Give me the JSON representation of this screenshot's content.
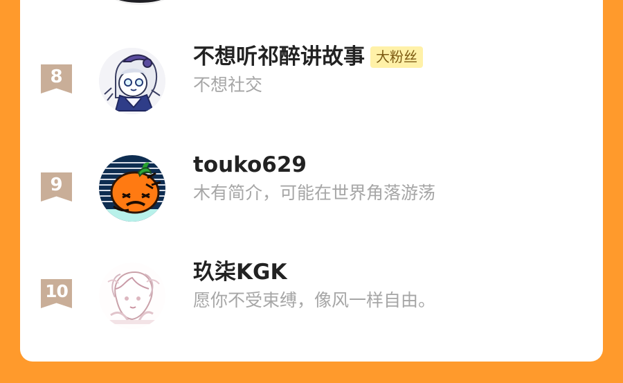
{
  "leaderboard": {
    "entries": [
      {
        "rank": "8",
        "username": "不想听祁醉讲故事",
        "badge": "大粉丝",
        "bio": "不想社交",
        "avatar_icon": "anime-girl-portrait-avatar"
      },
      {
        "rank": "9",
        "username": "touko629",
        "badge": "",
        "bio": "木有简介，可能在世界角落游荡",
        "avatar_icon": "angry-orange-mascot-avatar"
      },
      {
        "rank": "10",
        "username": "玖柒KGK",
        "badge": "",
        "bio": "愿你不受束缚，像风一样自由。",
        "avatar_icon": "pink-sketch-girl-avatar"
      }
    ]
  },
  "colors": {
    "background": "#FF9A2C",
    "card": "#FFFFFF",
    "rank_badge": "#C9AE98",
    "fan_badge": "#FFF1A8",
    "username": "#222222",
    "bio": "#A6A6A6"
  }
}
